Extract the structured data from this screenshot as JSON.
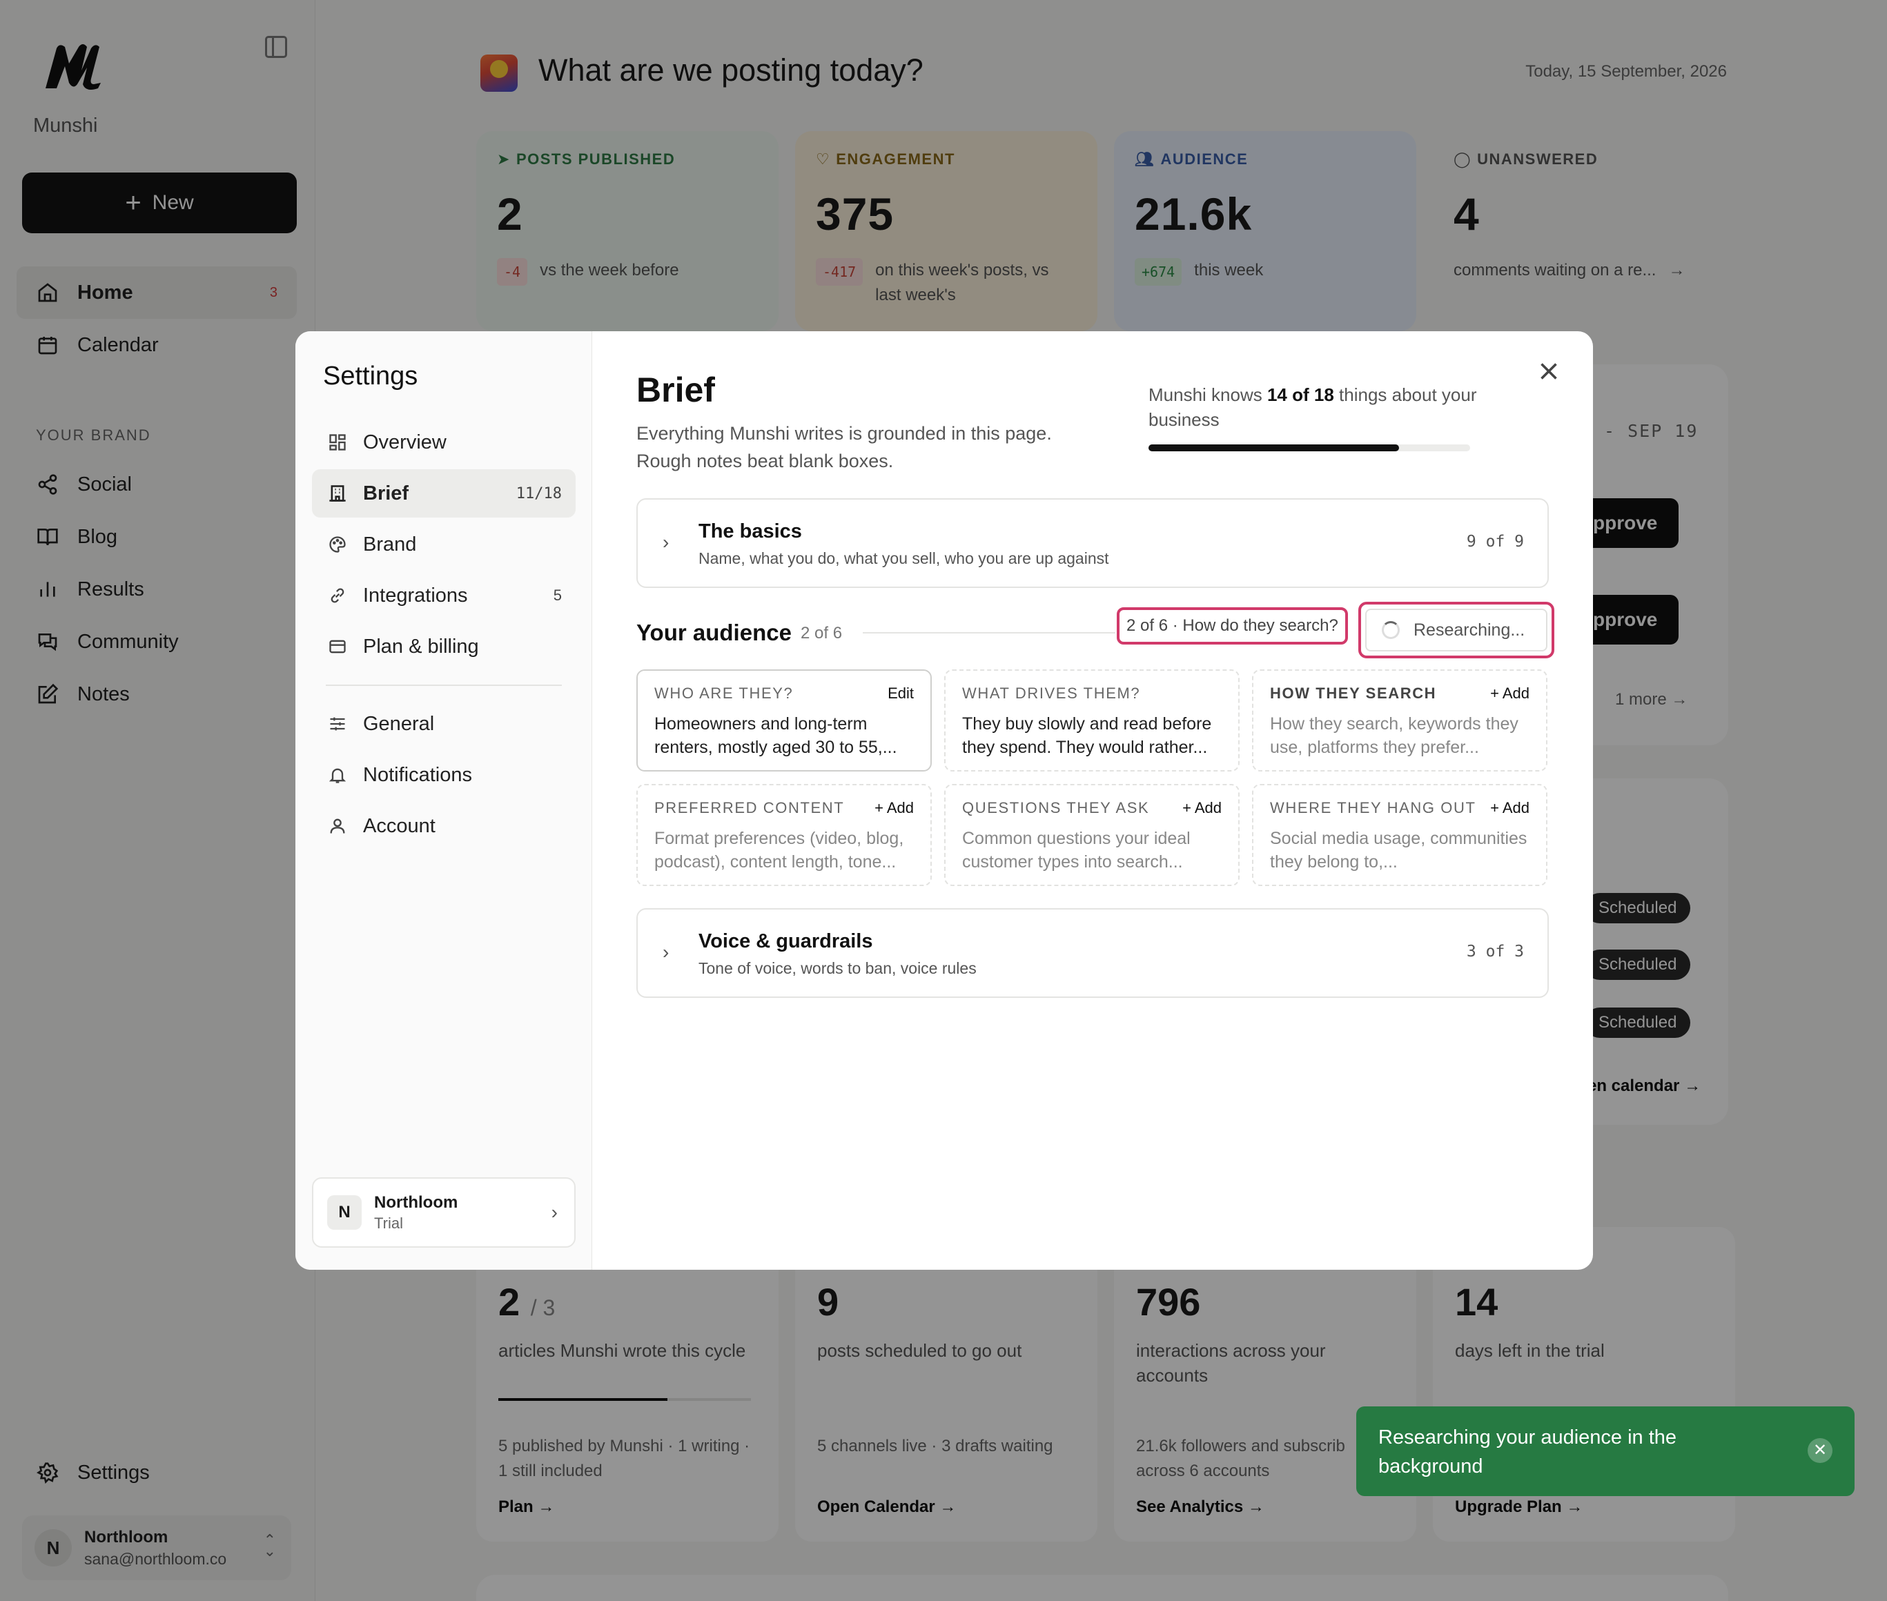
{
  "app": {
    "name": "Munshi"
  },
  "sidebar": {
    "new_label": "New",
    "nav": [
      {
        "label": "Home",
        "badge": "3"
      },
      {
        "label": "Calendar"
      }
    ],
    "section_label": "YOUR BRAND",
    "brand_nav": [
      {
        "label": "Social"
      },
      {
        "label": "Blog"
      },
      {
        "label": "Results"
      },
      {
        "label": "Community"
      },
      {
        "label": "Notes"
      }
    ],
    "settings_label": "Settings",
    "user": {
      "initial": "N",
      "name": "Northloom",
      "email": "sana@northloom.co"
    }
  },
  "header": {
    "title": "What are we posting today?",
    "date": "Today, 15 September, 2026"
  },
  "stats": [
    {
      "label": "POSTS PUBLISHED",
      "value": "2",
      "delta": "-4",
      "sub": "vs the week before",
      "color": "#2f7a45"
    },
    {
      "label": "ENGAGEMENT",
      "value": "375",
      "delta": "-417",
      "sub": "on this week's posts, vs last week's",
      "color": "#8a6a1a"
    },
    {
      "label": "AUDIENCE",
      "value": "21.6k",
      "delta": "+674",
      "sub": "this week",
      "color": "#3a5ea8"
    },
    {
      "label": "UNANSWERED",
      "value": "4",
      "sub": "comments waiting on a re...",
      "color": "#555555"
    }
  ],
  "background": {
    "date_range": "- SEP 19",
    "approve": "pprove",
    "more": "1 more",
    "scheduled": "Scheduled",
    "calendar_link": "en calendar →"
  },
  "bottom_stats": [
    {
      "value": "2",
      "of": "/ 3",
      "desc": "articles Munshi wrote this cycle",
      "progress": 0.67,
      "foot": "5 published by Munshi · 1 writing · 1 still included",
      "link": "Plan →"
    },
    {
      "value": "9",
      "desc": "posts scheduled to go out",
      "foot": "5 channels live · 3 drafts waiting",
      "link": "Open Calendar →"
    },
    {
      "value": "796",
      "desc": "interactions across your accounts",
      "foot": "21.6k followers and subscrib across 6 accounts",
      "link": "See Analytics →"
    },
    {
      "value": "14",
      "desc": "days left in the trial",
      "link": "Upgrade Plan →"
    }
  ],
  "modal": {
    "title": "Settings",
    "menu": [
      {
        "label": "Overview"
      },
      {
        "label": "Brief",
        "count": "11/18"
      },
      {
        "label": "Brand"
      },
      {
        "label": "Integrations",
        "count": "5"
      },
      {
        "label": "Plan & billing"
      }
    ],
    "menu2": [
      {
        "label": "General"
      },
      {
        "label": "Notifications"
      },
      {
        "label": "Account"
      }
    ],
    "org": {
      "initial": "N",
      "name": "Northloom",
      "plan": "Trial"
    },
    "brief": {
      "title": "Brief",
      "description": "Everything Munshi writes is grounded in this page. Rough notes beat blank boxes.",
      "knows_prefix": "Munshi knows ",
      "knows_count": "14 of 18",
      "knows_suffix": " things about your business",
      "progress": 0.78,
      "basics": {
        "title": "The basics",
        "subtitle": "Name, what you do, what you sell, who you are up against",
        "count": "9 of 9"
      },
      "audience": {
        "title": "Your audience",
        "count": "2 of 6",
        "step": "2 of 6 · How do they search?",
        "researching": "Researching...",
        "cards": [
          {
            "label": "WHO ARE THEY?",
            "action": "Edit",
            "text": "Homeowners and long-term renters, mostly aged 30 to 55,..."
          },
          {
            "label": "WHAT DRIVES THEM?",
            "action": "",
            "text": "They buy slowly and read before they spend. They would rather..."
          },
          {
            "label": "HOW THEY SEARCH",
            "action": "+ Add",
            "text": "How they search, keywords they use, platforms they prefer..."
          },
          {
            "label": "PREFERRED CONTENT",
            "action": "+ Add",
            "text": "Format preferences (video, blog, podcast), content length, tone..."
          },
          {
            "label": "QUESTIONS THEY ASK",
            "action": "+ Add",
            "text": "Common questions your ideal customer types into search..."
          },
          {
            "label": "WHERE THEY HANG OUT",
            "action": "+ Add",
            "text": "Social media usage, communities they belong to,..."
          }
        ]
      },
      "voice": {
        "title": "Voice & guardrails",
        "subtitle": "Tone of voice, words to ban, voice rules",
        "count": "3 of 3"
      }
    }
  },
  "toast": {
    "text": "Researching your audience in the background"
  }
}
